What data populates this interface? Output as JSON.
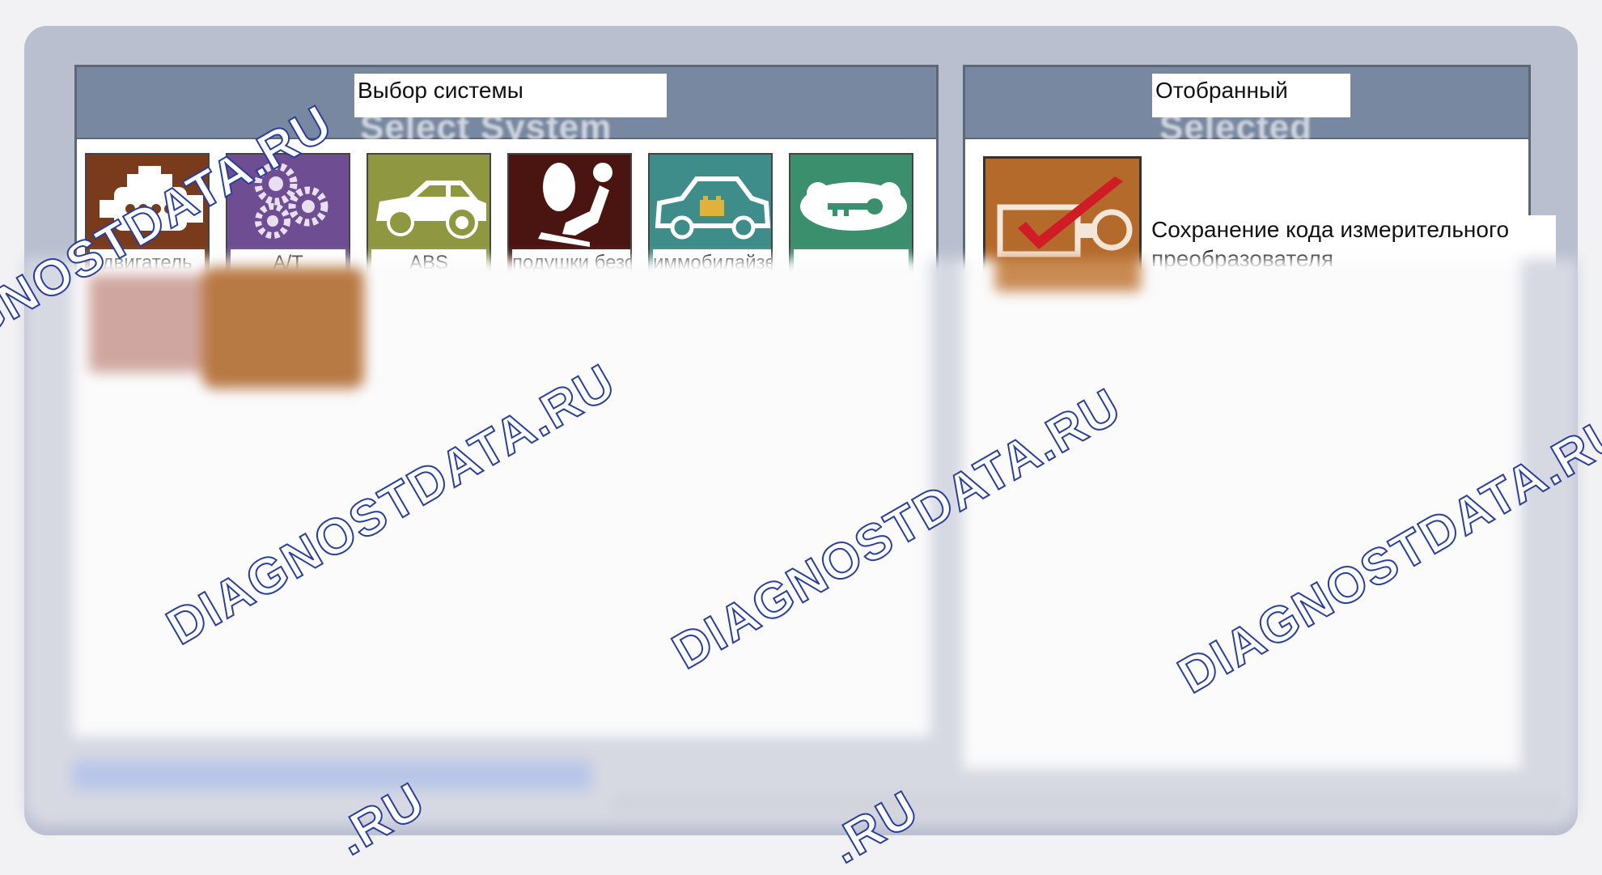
{
  "left_panel": {
    "title": "Выбор системы",
    "ghost_title": "Select System",
    "tiles": [
      {
        "label": "двигатель",
        "icon": "engine-icon",
        "color": "#7a3a1c"
      },
      {
        "label": "A/T",
        "icon": "gears-icon",
        "color": "#6e4d92"
      },
      {
        "label": "ABS",
        "icon": "car-brake-icon",
        "color": "#8f9741"
      },
      {
        "label": "подушки безопасности",
        "icon": "airbag-icon",
        "color": "#4a1410"
      },
      {
        "label": "иммобилайзер",
        "icon": "car-battery-icon",
        "color": "#3e8d8a"
      },
      {
        "label": "",
        "icon": "car-key-icon",
        "color": "#3b8f6d"
      }
    ]
  },
  "right_panel": {
    "title": "Отобранный",
    "ghost_title": "Selected",
    "selected_icon": "key-check-icon",
    "selected_color": "#b46a2b",
    "selected_text": "Сохранение кода измерительного преобразователя"
  },
  "watermark": "DIAGNOSTDATA.RU",
  "watermark_partial": ".RU"
}
